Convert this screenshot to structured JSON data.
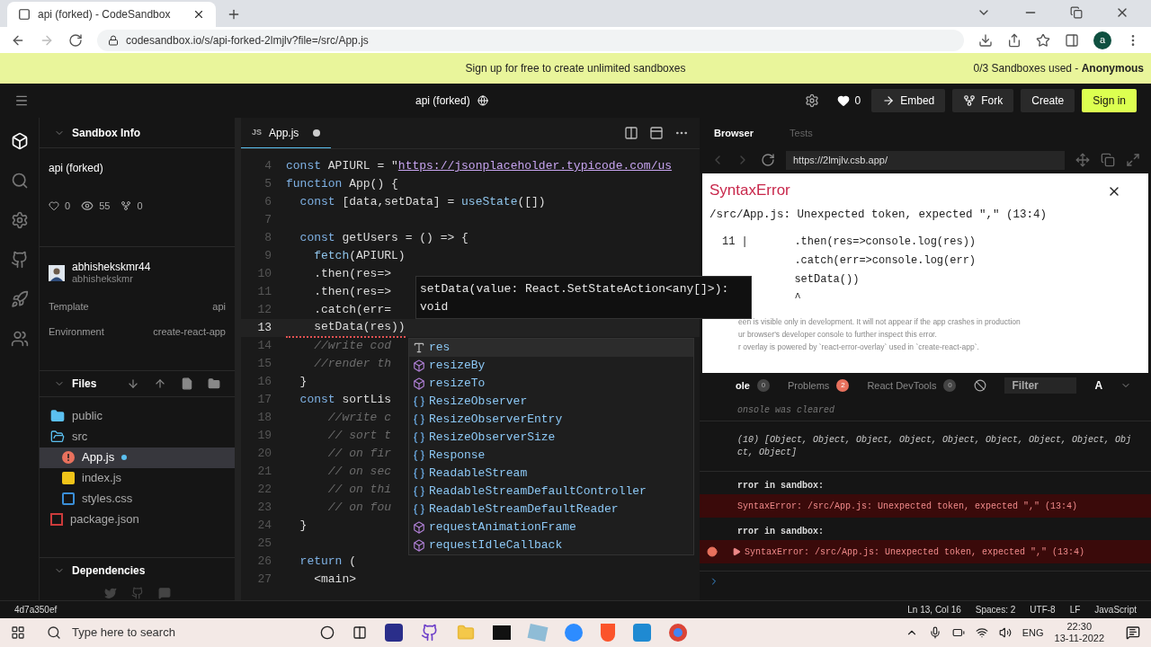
{
  "browser": {
    "tab_title": "api (forked) - CodeSandbox",
    "url": "codesandbox.io/s/api-forked-2lmjlv?file=/src/App.js",
    "profile": "a"
  },
  "banner": {
    "text": "Sign up for free to create unlimited sandboxes",
    "usage": "0/3 Sandboxes used - ",
    "user": "Anonymous"
  },
  "header": {
    "title": "api (forked)",
    "likes": "0",
    "buttons": [
      {
        "label": "Embed",
        "kind": "embed"
      },
      {
        "label": "Fork",
        "kind": "fork"
      },
      {
        "label": "Create",
        "kind": "plain"
      },
      {
        "label": "Sign in",
        "kind": "primary"
      }
    ]
  },
  "activity_bar": [
    {
      "kind": "cube",
      "selected": true
    },
    {
      "kind": "search",
      "selected": false
    },
    {
      "kind": "gear",
      "selected": false
    },
    {
      "kind": "github",
      "selected": false
    },
    {
      "kind": "rocket",
      "selected": false
    },
    {
      "kind": "users",
      "selected": false
    }
  ],
  "sandbox_info": {
    "title": "Sandbox Info",
    "name": "api (forked)",
    "likes": "0",
    "views": "55",
    "forks": "0",
    "author": "abhishekskmr44",
    "username": "abhishekskmr",
    "fields": [
      {
        "label": "Template",
        "value": "api"
      },
      {
        "label": "Environment",
        "value": "create-react-app"
      }
    ]
  },
  "files": {
    "title": "Files",
    "tree": [
      {
        "name": "public",
        "kind": "folder",
        "expanded": false,
        "selected": false
      },
      {
        "name": "src",
        "kind": "folder",
        "expanded": true,
        "selected": false,
        "children": [
          {
            "name": "App.js",
            "kind": "js",
            "error": true,
            "modified": true,
            "selected": true
          },
          {
            "name": "index.js",
            "kind": "js",
            "error": false,
            "modified": false,
            "selected": false
          },
          {
            "name": "styles.css",
            "kind": "css",
            "error": false,
            "modified": false,
            "selected": false
          }
        ]
      },
      {
        "name": "package.json",
        "kind": "npm",
        "selected": false
      }
    ]
  },
  "dependencies": {
    "title": "Dependencies"
  },
  "editor": {
    "tab": {
      "icon_text": "JS",
      "label": "App.js",
      "modified": true,
      "selected": true
    },
    "lines": [
      {
        "num": "4",
        "active": false,
        "tokens": [
          {
            "text": "const ",
            "kind": "kw"
          },
          {
            "text": "APIURL = \"",
            "kind": "id"
          },
          {
            "text": "https://jsonplaceholder.typicode.com/us",
            "kind": "url"
          }
        ]
      },
      {
        "num": "5",
        "active": false,
        "tokens": [
          {
            "text": "function ",
            "kind": "kw"
          },
          {
            "text": "App() {",
            "kind": "id"
          }
        ]
      },
      {
        "num": "6",
        "active": false,
        "tokens": [
          {
            "text": "  const ",
            "kind": "kw"
          },
          {
            "text": "[data,setData] = ",
            "kind": "id"
          },
          {
            "text": "useState",
            "kind": "fn"
          },
          {
            "text": "([])",
            "kind": "id"
          }
        ]
      },
      {
        "num": "7",
        "active": false
      },
      {
        "num": "8",
        "active": false,
        "tokens": [
          {
            "text": "  const ",
            "kind": "kw"
          },
          {
            "text": "getUsers = () => {",
            "kind": "id"
          }
        ]
      },
      {
        "num": "9",
        "active": false,
        "tokens": [
          {
            "text": "    fetch",
            "kind": "fn"
          },
          {
            "text": "(APIURL)",
            "kind": "id"
          }
        ]
      },
      {
        "num": "10",
        "active": false,
        "tokens": [
          {
            "text": "    .then(res=>",
            "kind": "id"
          }
        ]
      },
      {
        "num": "11",
        "active": false,
        "tokens": [
          {
            "text": "    .then(res=>",
            "kind": "id"
          }
        ]
      },
      {
        "num": "12",
        "active": false,
        "tokens": [
          {
            "text": "    .catch(err=",
            "kind": "id"
          }
        ]
      },
      {
        "num": "13",
        "active": true,
        "error": true,
        "tokens": [
          {
            "text": "    setData(res",
            "kind": "id"
          },
          {
            "text": "))",
            "kind": "id"
          }
        ]
      },
      {
        "num": "14",
        "active": false,
        "tokens": [
          {
            "text": "    //write cod",
            "kind": "cmt"
          }
        ]
      },
      {
        "num": "15",
        "active": false,
        "tokens": [
          {
            "text": "    //render th",
            "kind": "cmt"
          }
        ]
      },
      {
        "num": "16",
        "active": false,
        "tokens": [
          {
            "text": "  }",
            "kind": "id"
          }
        ]
      },
      {
        "num": "17",
        "active": false,
        "tokens": [
          {
            "text": "  const ",
            "kind": "kw"
          },
          {
            "text": "sortLis",
            "kind": "id"
          }
        ]
      },
      {
        "num": "18",
        "active": false,
        "tokens": [
          {
            "text": "      //write c",
            "kind": "cmt"
          }
        ]
      },
      {
        "num": "19",
        "active": false,
        "tokens": [
          {
            "text": "      // sort t",
            "kind": "cmt"
          }
        ]
      },
      {
        "num": "20",
        "active": false,
        "tokens": [
          {
            "text": "      // on fir",
            "kind": "cmt"
          }
        ]
      },
      {
        "num": "21",
        "active": false,
        "tokens": [
          {
            "text": "      // on sec",
            "kind": "cmt"
          }
        ]
      },
      {
        "num": "22",
        "active": false,
        "tokens": [
          {
            "text": "      // on thi",
            "kind": "cmt"
          }
        ]
      },
      {
        "num": "23",
        "active": false,
        "tokens": [
          {
            "text": "      // on fou",
            "kind": "cmt"
          }
        ]
      },
      {
        "num": "24",
        "active": false,
        "tokens": [
          {
            "text": "  }",
            "kind": "id"
          }
        ]
      },
      {
        "num": "25",
        "active": false
      },
      {
        "num": "26",
        "active": false,
        "tokens": [
          {
            "text": "  return ",
            "kind": "kw"
          },
          {
            "text": "(",
            "kind": "id"
          }
        ]
      },
      {
        "num": "27",
        "active": false,
        "tokens": [
          {
            "text": "    <main>",
            "kind": "id"
          }
        ]
      }
    ],
    "tooltip": {
      "signature": "setData(value: React.SetStateAction<any[]>):",
      "returns": "void"
    },
    "suggestions": [
      {
        "label": "res",
        "kind": "text",
        "selected": true
      },
      {
        "label": "resizeBy",
        "kind": "method",
        "selected": false
      },
      {
        "label": "resizeTo",
        "kind": "method",
        "selected": false
      },
      {
        "label": "ResizeObserver",
        "kind": "variable",
        "selected": false
      },
      {
        "label": "ResizeObserverEntry",
        "kind": "variable",
        "selected": false
      },
      {
        "label": "ResizeObserverSize",
        "kind": "variable",
        "selected": false
      },
      {
        "label": "Response",
        "kind": "variable",
        "selected": false
      },
      {
        "label": "ReadableStream",
        "kind": "variable",
        "selected": false
      },
      {
        "label": "ReadableStreamDefaultController",
        "kind": "variable",
        "selected": false
      },
      {
        "label": "ReadableStreamDefaultReader",
        "kind": "variable",
        "selected": false
      },
      {
        "label": "requestAnimationFrame",
        "kind": "method",
        "selected": false
      },
      {
        "label": "requestIdleCallback",
        "kind": "method",
        "selected": false
      }
    ]
  },
  "preview": {
    "tabs": [
      {
        "label": "Browser",
        "selected": true
      },
      {
        "label": "Tests",
        "selected": false
      }
    ],
    "url": "https://2lmjlv.csb.app/",
    "error_overlay": {
      "title": "SyntaxError",
      "message": "/src/App.js: Unexpected token, expected \",\" (13:4)",
      "frame": [
        {
          "num": "11 |",
          "code": "  .then(res=>console.log(res))"
        },
        {
          "code": "  .catch(err=>console.log(err)"
        },
        {
          "code": "  setData())"
        },
        {
          "code": "  ^"
        }
      ],
      "notes": [
        "een is visible only in development. It will not appear if the app crashes in production",
        "ur browser's developer console to further inspect this error.",
        "r overlay is powered by `react-error-overlay` used in `create-react-app`."
      ]
    },
    "console_tabs": [
      {
        "label": "ole",
        "count": "0",
        "alert": false,
        "selected": true
      },
      {
        "label": "Problems",
        "count": "2",
        "alert": true,
        "selected": false
      },
      {
        "label": "React DevTools",
        "count": "0",
        "alert": false,
        "selected": false
      }
    ],
    "filter_placeholder": "Filter",
    "font_toggle": "A",
    "console": [
      {
        "kind": "info",
        "text": "onsole was cleared"
      },
      {
        "kind": "log",
        "text": "(10) [Object, Object, Object, Object, Object, Object, Object, Object, Obj\nct, Object]"
      },
      {
        "kind": "label",
        "text": "rror in sandbox:"
      },
      {
        "kind": "error",
        "text": "SyntaxError: /src/App.js: Unexpected token, expected \",\" (13:4)",
        "expandable": false
      },
      {
        "kind": "label",
        "text": "rror in sandbox:"
      },
      {
        "kind": "error",
        "text": "SyntaxError: /src/App.js: Unexpected token, expected \",\" (13:4)",
        "expandable": true
      }
    ]
  },
  "status_bar": {
    "commit": "4d7a350ef",
    "items": [
      "Ln 13, Col 16",
      "Spaces: 2",
      "UTF-8",
      "LF",
      "JavaScript"
    ]
  },
  "taskbar": {
    "search_placeholder": "Type here to search",
    "language": "ENG",
    "time": "22:30",
    "date": "13-11-2022"
  }
}
